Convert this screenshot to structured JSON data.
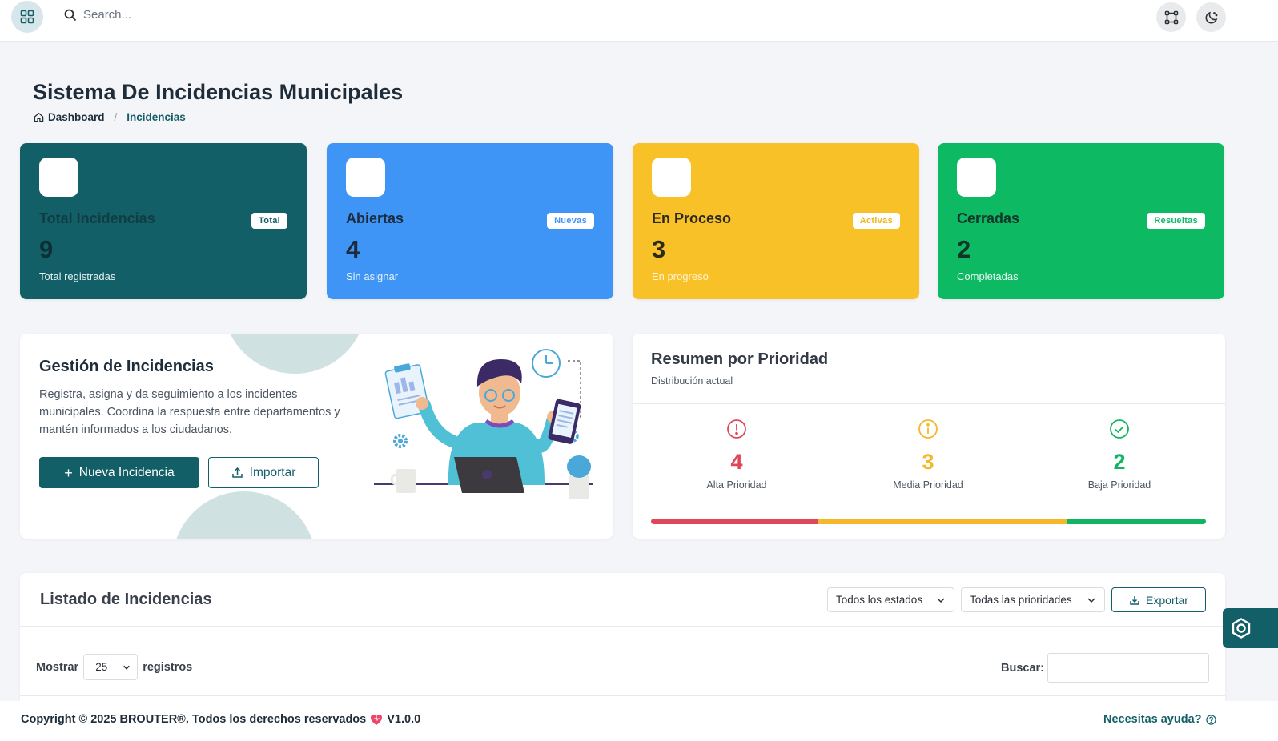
{
  "topbar": {
    "search_placeholder": "Search..."
  },
  "header": {
    "title": "Sistema De Incidencias Municipales",
    "breadcrumb_home": "Dashboard",
    "breadcrumb_separator": "/",
    "breadcrumb_current": "Incidencias"
  },
  "stats": [
    {
      "label": "Total Incidencias",
      "badge": "Total",
      "value": "9",
      "sub": "Total registradas",
      "color": "#135f68"
    },
    {
      "label": "Abiertas",
      "badge": "Nuevas",
      "value": "4",
      "sub": "Sin asignar",
      "color": "#3e95f5"
    },
    {
      "label": "En Proceso",
      "badge": "Activas",
      "value": "3",
      "sub": "En progreso",
      "color": "#f8c127"
    },
    {
      "label": "Cerradas",
      "badge": "Resueltas",
      "value": "2",
      "sub": "Completadas",
      "color": "#0db963"
    }
  ],
  "management": {
    "title": "Gestión de Incidencias",
    "description": "Registra, asigna y da seguimiento a los incidentes municipales. Coordina la respuesta entre departamentos y mantén informados a los ciudadanos.",
    "primary_button": "Nueva Incidencia",
    "secondary_button": "Importar"
  },
  "priority": {
    "title": "Resumen por Prioridad",
    "subtitle": "Distribución actual",
    "items": [
      {
        "value": "4",
        "label": "Alta Prioridad",
        "color": "#e0465a",
        "icon": "alert-circle-icon"
      },
      {
        "value": "3",
        "label": "Media Prioridad",
        "color": "#f5b82a",
        "icon": "info-circle-icon"
      },
      {
        "value": "2",
        "label": "Baja Prioridad",
        "color": "#10b564",
        "icon": "check-circle-icon"
      }
    ],
    "bar_fractions": [
      0.3,
      0.45,
      0.25
    ]
  },
  "list": {
    "title": "Listado de Incidencias",
    "filter_status": "Todos los estados",
    "filter_priority": "Todas las prioridades",
    "export_button": "Exportar",
    "show_label": "Mostrar",
    "page_size": "25",
    "records_label": "registros",
    "search_label": "Buscar:"
  },
  "footer": {
    "copyright": "Copyright © 2025 BROUTER®. Todos los derechos reservados",
    "version": "V1.0.0",
    "help": "Necesitas ayuda?"
  },
  "colors": {
    "brand": "#135f68",
    "background": "#f4f5f8"
  }
}
